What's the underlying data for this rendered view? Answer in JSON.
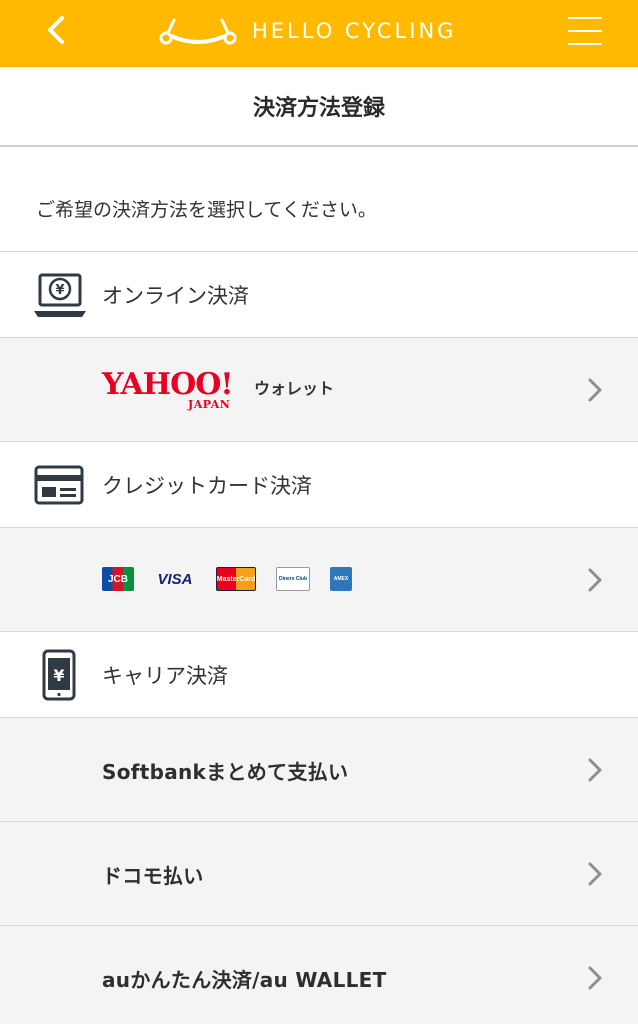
{
  "header": {
    "brand": "HELLO CYCLING",
    "accent": "#ffba00"
  },
  "page": {
    "title": "決済方法登録",
    "intro": "ご希望の決済方法を選択してください。"
  },
  "sections": {
    "online": {
      "label": "オンライン決済",
      "icon": "laptop-yen-icon"
    },
    "credit": {
      "label": "クレジットカード決済",
      "icon": "credit-card-icon"
    },
    "carrier": {
      "label": "キャリア決済",
      "icon": "smartphone-yen-icon"
    }
  },
  "online_options": {
    "yahoo": {
      "logo_main": "YAHOO!",
      "logo_sub": "JAPAN",
      "wallet": "ウォレット"
    }
  },
  "credit_options": {
    "brands": {
      "jcb": "JCB",
      "visa": "VISA",
      "mastercard": "MasterCard",
      "diners": "Diners Club",
      "amex": "AMEX"
    }
  },
  "carrier_options": [
    {
      "label": "Softbankまとめて支払い"
    },
    {
      "label": "ドコモ払い"
    },
    {
      "label": "auかんたん決済/au WALLET"
    }
  ]
}
